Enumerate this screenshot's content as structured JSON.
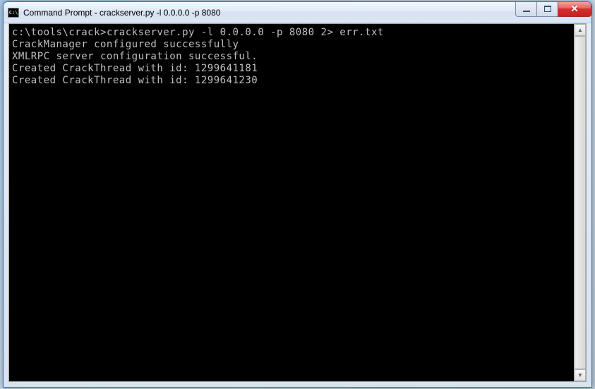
{
  "window": {
    "icon_label": "C:\\",
    "title": "Command Prompt - crackserver.py  -l 0.0.0.0 -p 8080"
  },
  "console": {
    "prompt": "c:\\tools\\crack>",
    "command": "crackserver.py -l 0.0.0.0 -p 8080 2> err.txt",
    "lines": [
      "CrackManager configured successfully",
      "XMLRPC server configuration successful.",
      "Created CrackThread with id: 1299641181",
      "Created CrackThread with id: 1299641230"
    ]
  }
}
